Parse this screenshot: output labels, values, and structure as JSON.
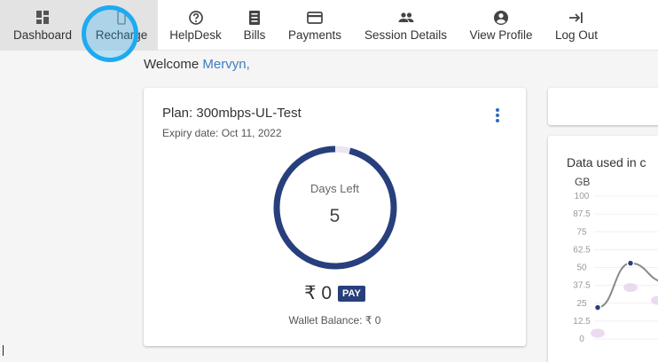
{
  "nav": {
    "items": [
      {
        "label": "Dashboard",
        "icon": "dashboard-icon"
      },
      {
        "label": "Recharge",
        "icon": "recharge-icon"
      },
      {
        "label": "HelpDesk",
        "icon": "help-icon"
      },
      {
        "label": "Bills",
        "icon": "bills-icon"
      },
      {
        "label": "Payments",
        "icon": "payments-icon"
      },
      {
        "label": "Session Details",
        "icon": "group-icon"
      },
      {
        "label": "View Profile",
        "icon": "profile-icon"
      },
      {
        "label": "Log Out",
        "icon": "logout-icon"
      }
    ]
  },
  "welcome": {
    "prefix": "Welcome",
    "user": "Mervyn,"
  },
  "plan": {
    "title": "Plan: 300mbps-UL-Test",
    "expiry": "Expiry date: Oct 11, 2022",
    "days_left_label": "Days Left",
    "days_left_value": "5",
    "gauge_fraction": 0.96,
    "price": "₹ 0",
    "pay_label": "PAY",
    "wallet": "Wallet Balance: ₹ 0"
  },
  "colors": {
    "accent": "#273f7c",
    "link": "#3b7dc4",
    "highlight_ring": "#1eaaf1"
  },
  "data_card": {
    "title": "Data used in c",
    "ylabel": "GB"
  },
  "chart_data": {
    "type": "line",
    "title": "Data used in c",
    "ylabel": "GB",
    "yticks": [
      "100",
      "87.5",
      "75",
      "62.5",
      "50",
      "37.5",
      "25",
      "12.5",
      "0"
    ],
    "ylim": [
      0,
      100
    ],
    "series": [
      {
        "values": [
          22,
          53,
          40
        ]
      }
    ]
  }
}
